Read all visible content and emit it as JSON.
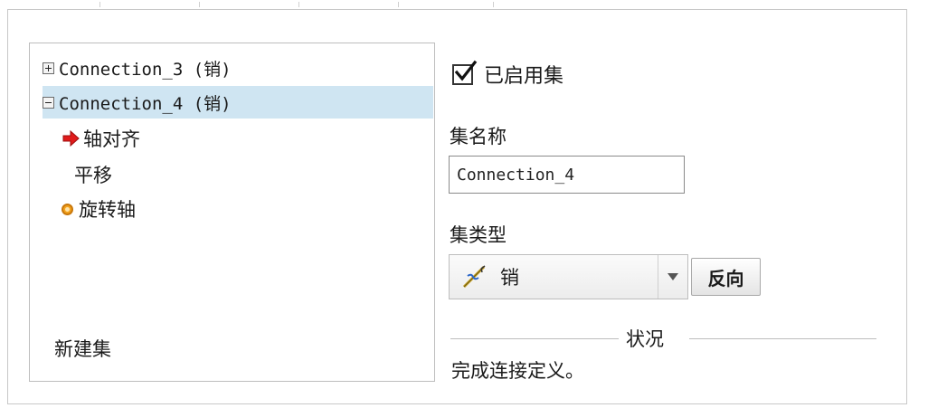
{
  "tree": {
    "items": [
      {
        "label": "Connection_3 (销)",
        "expanded": false,
        "selected": false
      },
      {
        "label": "Connection_4 (销)",
        "expanded": true,
        "selected": true,
        "children": [
          {
            "label": "轴对齐",
            "icon": "red-arrow-icon"
          },
          {
            "label": "平移",
            "icon": ""
          },
          {
            "label": "旋转轴",
            "icon": "orange-dot-icon"
          }
        ]
      }
    ],
    "new_set_label": "新建集"
  },
  "set_enabled": {
    "label": "已启用集",
    "checked": true
  },
  "set_name": {
    "label": "集名称",
    "value": "Connection_4"
  },
  "set_type": {
    "label": "集类型",
    "value": "销",
    "icon": "pin-connection-icon"
  },
  "flip_button": {
    "label": "反向"
  },
  "status": {
    "title": "状况",
    "text": "完成连接定义。"
  },
  "colors": {
    "selection": "#cfe5f2",
    "arrow": "#e01b1b",
    "dot": "#f3a21c"
  }
}
